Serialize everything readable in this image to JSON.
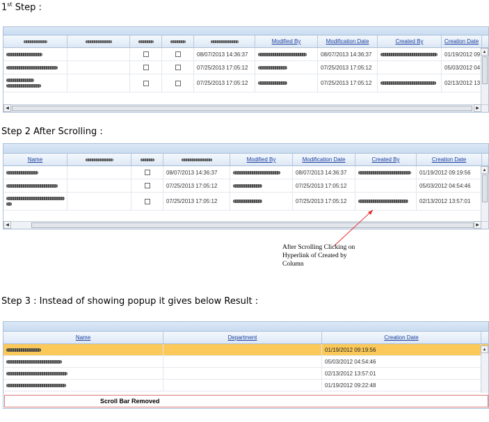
{
  "steps": {
    "step1": {
      "title_main": "1",
      "title_sup": "st",
      "title_rest": " Step :"
    },
    "step2": {
      "title": "Step 2 After Scrolling :"
    },
    "step3": {
      "title": "Step 3 : Instead of showing popup it gives below Result :"
    }
  },
  "grid1": {
    "headers": [
      "Modified By",
      "Modification Date",
      "Created By",
      "Creation Date"
    ],
    "rows": [
      {
        "modified1": "08/07/2013 14:36:37",
        "modified2": "08/07/2013 14:36:37",
        "creation": "01/19/2012 09"
      },
      {
        "modified1": "07/25/2013 17:05:12",
        "modified2": "07/25/2013 17:05:12",
        "creation": "05/03/2012 04"
      },
      {
        "modified1": "07/25/2013 17:05:12",
        "modified2": "07/25/2013 17:05:12",
        "creation": "02/13/2012 13"
      }
    ]
  },
  "grid2": {
    "headers": [
      "Name",
      "Modified By",
      "Modification Date",
      "Created By",
      "Creation Date"
    ],
    "rows": [
      {
        "modified1": "08/07/2013 14:36:37",
        "modified2": "08/07/2013 14:36:37",
        "creation": "01/19/2012 09:19:56"
      },
      {
        "modified1": "07/25/2013 17:05:12",
        "modified2": "07/25/2013 17:05:12",
        "creation": "05/03/2012 04:54:46"
      },
      {
        "modified1": "07/25/2013 17:05:12",
        "modified2": "07/25/2013 17:05:12",
        "creation": "02/13/2012 13:57:01"
      }
    ]
  },
  "annotation": {
    "line1": "After Scrolling Clicking on",
    "line2": "Hyperlink of Created by",
    "line3": "Column"
  },
  "grid3": {
    "headers": [
      "Name",
      "Department",
      "Creation Date"
    ],
    "rows": [
      {
        "creation": "01/19/2012 09:19:56"
      },
      {
        "creation": "05/03/2012 04:54:46"
      },
      {
        "creation": "02/13/2012 13:57:01"
      },
      {
        "creation": "01/19/2012 09:22:48"
      }
    ],
    "removed_label": "Scroll Bar Removed"
  },
  "colors": {
    "selected_row": "#fbc95a",
    "header_link": "#1a3fa0",
    "annotation_arrow": "#e03030",
    "removed_box": "#d87a7a"
  }
}
